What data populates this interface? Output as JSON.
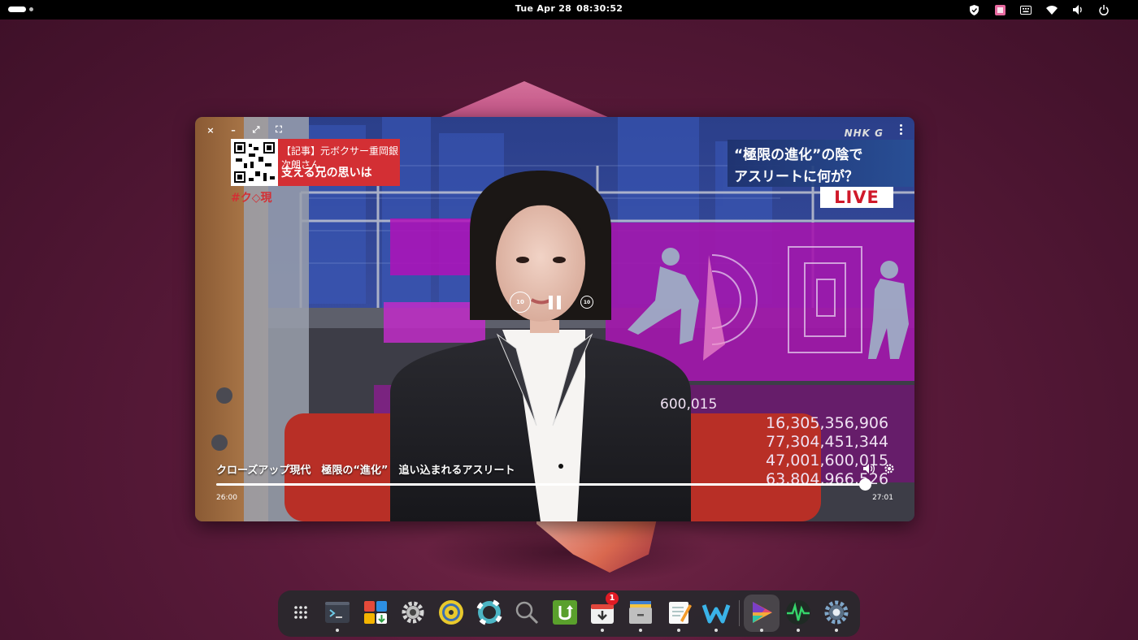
{
  "topbar": {
    "date": "Tue Apr 28",
    "time": "08:30:52",
    "tray": [
      {
        "icon": "shield-icon"
      },
      {
        "icon": "app-indicator-icon"
      },
      {
        "icon": "keyboard-icon"
      },
      {
        "icon": "wifi-icon"
      },
      {
        "icon": "volume-icon"
      },
      {
        "icon": "power-icon"
      }
    ]
  },
  "player": {
    "window_controls": [
      "×",
      "–",
      "⤢",
      "⛶"
    ],
    "broadcast": {
      "news_tag": "【記事】元ボクサー重岡銀次朗さん",
      "news_title": "支える兄の思いは",
      "hashtag": "#ク◇現",
      "channel": "NHK G",
      "topic_line1": "“極限の進化”の陰で",
      "topic_line2": "アスリートに何が？",
      "live": "LIVE",
      "stat_top": "600,015",
      "stats": [
        "16,305,356,906",
        "77,304,451,344",
        "47,001,600,015",
        "63,804,966,526"
      ]
    },
    "rewind_label": "10",
    "forward_label": "10",
    "title": "クローズアップ現代　極限の“進化”　追い込まれるアスリート",
    "progress": 0.998,
    "time_start": "26:00",
    "time_end": "27:01"
  },
  "dock": {
    "items": [
      {
        "name": "app-grid",
        "icon": "app-grid-icon",
        "running": false
      },
      {
        "name": "terminal",
        "icon": "terminal-icon",
        "running": true
      },
      {
        "name": "software-store",
        "icon": "store-icon",
        "running": false
      },
      {
        "name": "settings",
        "icon": "gear-icon",
        "running": false
      },
      {
        "name": "music-player",
        "icon": "music-icon",
        "running": false
      },
      {
        "name": "help",
        "icon": "lifebuoy-icon",
        "running": false
      },
      {
        "name": "search",
        "icon": "magnifier-icon",
        "running": false
      },
      {
        "name": "updater",
        "icon": "update-icon",
        "running": false
      },
      {
        "name": "downloads",
        "icon": "download-icon",
        "running": true,
        "badge": "1"
      },
      {
        "name": "file-manager",
        "icon": "drawer-icon",
        "running": true
      },
      {
        "name": "text-editor",
        "icon": "notepad-icon",
        "running": true
      },
      {
        "name": "webapp",
        "icon": "w-logo-icon",
        "running": true
      },
      {
        "name": "video-player",
        "icon": "play-logo-icon",
        "running": true,
        "active": true
      },
      {
        "name": "system-monitor",
        "icon": "pulse-icon",
        "running": true
      },
      {
        "name": "settings-2",
        "icon": "cog-icon",
        "running": true
      }
    ]
  },
  "colors": {
    "accent_red": "#d32f34",
    "topic_blue": "#1e326e",
    "dock_bg": "#28282c"
  }
}
